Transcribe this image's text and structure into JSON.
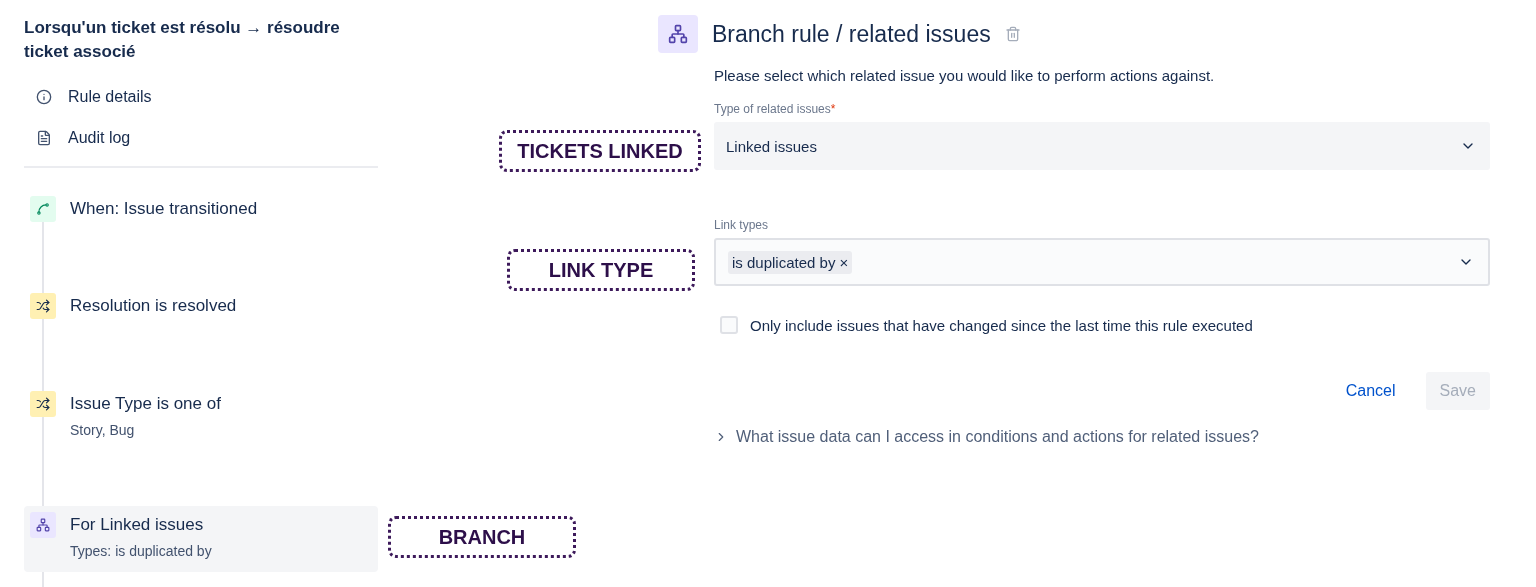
{
  "sidebar": {
    "title": "Lorsqu'un ticket est résolu → résoudre ticket associé",
    "links": [
      {
        "kind": "info",
        "label": "Rule details"
      },
      {
        "kind": "log",
        "label": "Audit log"
      }
    ],
    "steps": [
      {
        "kind": "trigger",
        "label": "When: Issue transitioned",
        "selected": false
      },
      {
        "kind": "condition",
        "label": "Resolution is resolved",
        "selected": false
      },
      {
        "kind": "condition",
        "label": "Issue Type is one of",
        "detail": "Story, Bug",
        "selected": false
      },
      {
        "kind": "branch",
        "label": "For Linked issues",
        "detail": "Types: is duplicated by",
        "selected": true
      }
    ]
  },
  "panel": {
    "title": "Branch rule / related issues",
    "description": "Please select which related issue you would like to perform actions against.",
    "related_type": {
      "label": "Type of related issues",
      "required_mark": "*",
      "value": "Linked issues"
    },
    "link_types": {
      "label": "Link types",
      "tags": [
        "is duplicated by"
      ],
      "remove": "×"
    },
    "only_changed": {
      "label": "Only include issues that have changed since the last time this rule executed",
      "checked": false
    },
    "buttons": [
      {
        "kind": "link",
        "label": "Cancel",
        "disabled": false
      },
      {
        "kind": "primary",
        "label": "Save",
        "disabled": true
      }
    ],
    "help": {
      "label": "What issue data can I access in conditions and actions for related issues?",
      "expanded": false
    }
  },
  "callouts": [
    {
      "label": "TICKETS LINKED"
    },
    {
      "label": "LINK TYPE"
    },
    {
      "label": "BRANCH"
    }
  ]
}
